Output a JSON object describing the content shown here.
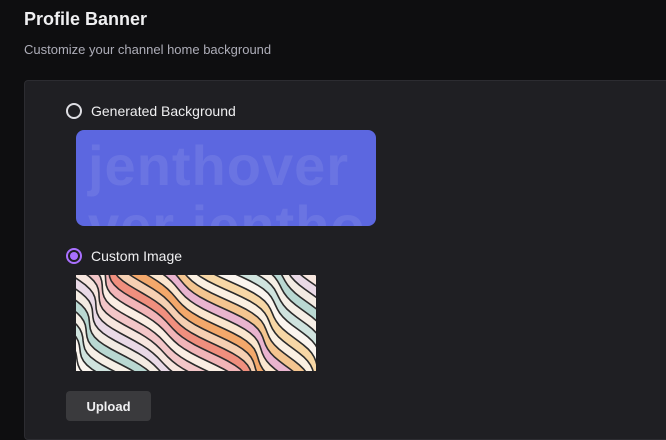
{
  "header": {
    "title": "Profile Banner",
    "subtitle": "Customize your channel home background"
  },
  "options": {
    "generated": {
      "label": "Generated Background",
      "selected": false,
      "preview_text_line1": "jenthover",
      "preview_text_line2": "ver jentho",
      "preview_color": "#5c67e0"
    },
    "custom": {
      "label": "Custom Image",
      "selected": true
    }
  },
  "actions": {
    "upload_label": "Upload"
  },
  "colors": {
    "accent": "#a970ff",
    "panel": "#1f1f23",
    "page": "#0e0e10"
  }
}
